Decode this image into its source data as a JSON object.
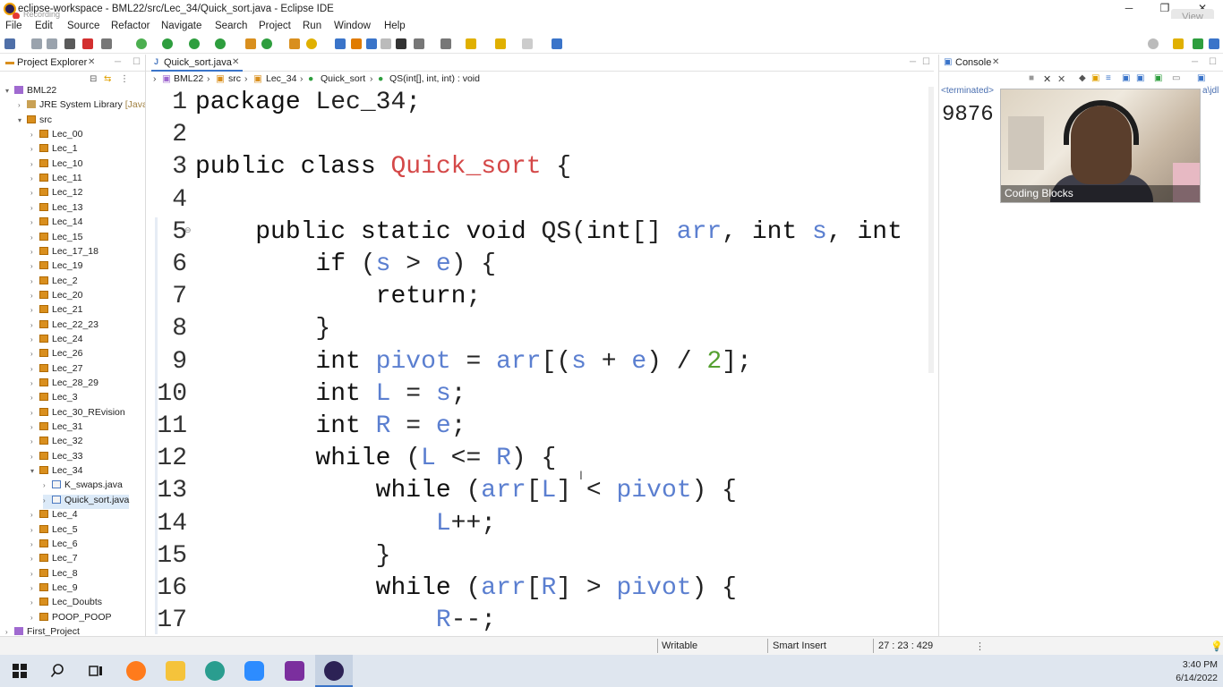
{
  "window": {
    "title": "eclipse-workspace - BML22/src/Lec_34/Quick_sort.java - Eclipse IDE",
    "recording_label": "Recording",
    "view_button": "View"
  },
  "menu": [
    "File",
    "Edit",
    "Source",
    "Refactor",
    "Navigate",
    "Search",
    "Project",
    "Run",
    "Window",
    "Help"
  ],
  "explorer": {
    "tab_label": "Project Explorer",
    "items": [
      {
        "label": "BML22",
        "kind": "project",
        "indent": 0,
        "expanded": true
      },
      {
        "label": "JRE System Library [Java",
        "kind": "lib",
        "indent": 1,
        "expanded": false
      },
      {
        "label": "src",
        "kind": "src",
        "indent": 1,
        "expanded": true
      },
      {
        "label": "Lec_00",
        "kind": "pkg",
        "indent": 2
      },
      {
        "label": "Lec_1",
        "kind": "pkg",
        "indent": 2
      },
      {
        "label": "Lec_10",
        "kind": "pkg",
        "indent": 2
      },
      {
        "label": "Lec_11",
        "kind": "pkg",
        "indent": 2
      },
      {
        "label": "Lec_12",
        "kind": "pkg",
        "indent": 2
      },
      {
        "label": "Lec_13",
        "kind": "pkg",
        "indent": 2
      },
      {
        "label": "Lec_14",
        "kind": "pkg",
        "indent": 2
      },
      {
        "label": "Lec_15",
        "kind": "pkg",
        "indent": 2
      },
      {
        "label": "Lec_17_18",
        "kind": "pkg",
        "indent": 2
      },
      {
        "label": "Lec_19",
        "kind": "pkg",
        "indent": 2
      },
      {
        "label": "Lec_2",
        "kind": "pkg",
        "indent": 2
      },
      {
        "label": "Lec_20",
        "kind": "pkg",
        "indent": 2
      },
      {
        "label": "Lec_21",
        "kind": "pkg",
        "indent": 2
      },
      {
        "label": "Lec_22_23",
        "kind": "pkg",
        "indent": 2
      },
      {
        "label": "Lec_24",
        "kind": "pkg",
        "indent": 2
      },
      {
        "label": "Lec_26",
        "kind": "pkg",
        "indent": 2
      },
      {
        "label": "Lec_27",
        "kind": "pkg",
        "indent": 2
      },
      {
        "label": "Lec_28_29",
        "kind": "pkg",
        "indent": 2
      },
      {
        "label": "Lec_3",
        "kind": "pkg",
        "indent": 2
      },
      {
        "label": "Lec_30_REvision",
        "kind": "pkg",
        "indent": 2
      },
      {
        "label": "Lec_31",
        "kind": "pkg",
        "indent": 2
      },
      {
        "label": "Lec_32",
        "kind": "pkg",
        "indent": 2
      },
      {
        "label": "Lec_33",
        "kind": "pkg",
        "indent": 2
      },
      {
        "label": "Lec_34",
        "kind": "pkg",
        "indent": 2,
        "expanded": true
      },
      {
        "label": "K_swaps.java",
        "kind": "java",
        "indent": 3
      },
      {
        "label": "Quick_sort.java",
        "kind": "java",
        "indent": 3,
        "selected": true
      },
      {
        "label": "Lec_4",
        "kind": "pkg",
        "indent": 2
      },
      {
        "label": "Lec_5",
        "kind": "pkg",
        "indent": 2
      },
      {
        "label": "Lec_6",
        "kind": "pkg",
        "indent": 2
      },
      {
        "label": "Lec_7",
        "kind": "pkg",
        "indent": 2
      },
      {
        "label": "Lec_8",
        "kind": "pkg",
        "indent": 2
      },
      {
        "label": "Lec_9",
        "kind": "pkg",
        "indent": 2
      },
      {
        "label": "Lec_Doubts",
        "kind": "pkg",
        "indent": 2
      },
      {
        "label": "POOP_POOP",
        "kind": "pkg",
        "indent": 2
      },
      {
        "label": "First_Project",
        "kind": "project",
        "indent": 0
      }
    ]
  },
  "editor": {
    "tab_label": "Quick_sort.java",
    "breadcrumb": [
      "BML22",
      "src",
      "Lec_34",
      "Quick_sort",
      "QS(int[], int, int) : void"
    ],
    "lines": [
      {
        "n": "1",
        "code": "package Lec_34;"
      },
      {
        "n": "2",
        "code": ""
      },
      {
        "n": "3",
        "code": "public class Quick_sort {"
      },
      {
        "n": "4",
        "code": ""
      },
      {
        "n": "5",
        "code": "    public static void QS(int[] arr, int s, int"
      },
      {
        "n": "6",
        "code": "        if (s > e) {"
      },
      {
        "n": "7",
        "code": "            return;"
      },
      {
        "n": "8",
        "code": "        }"
      },
      {
        "n": "9",
        "code": "        int pivot = arr[(s + e) / 2];"
      },
      {
        "n": "10",
        "code": "        int L = s;"
      },
      {
        "n": "11",
        "code": "        int R = e;"
      },
      {
        "n": "12",
        "code": "        while (L <= R) {"
      },
      {
        "n": "13",
        "code": "            while (arr[L] < pivot) {"
      },
      {
        "n": "14",
        "code": "                L++;"
      },
      {
        "n": "15",
        "code": "            }"
      },
      {
        "n": "16",
        "code": "            while (arr[R] > pivot) {"
      },
      {
        "n": "17",
        "code": "                R--;"
      }
    ]
  },
  "console": {
    "tab_label": "Console",
    "status": "<terminated>",
    "path_fragment": "a\\jdl",
    "output": "9876",
    "webcam_label": "Coding Blocks"
  },
  "statusbar": {
    "mode": "Writable",
    "insert": "Smart Insert",
    "position": "27 : 23 : 429"
  },
  "taskbar": {
    "time": "3:40 PM",
    "date": "6/14/2022"
  },
  "colors": {
    "keyword": "#111111",
    "class_name": "#d44848",
    "variable": "#5b7fd0",
    "number": "#55a030",
    "accent": "#3a74c9"
  }
}
